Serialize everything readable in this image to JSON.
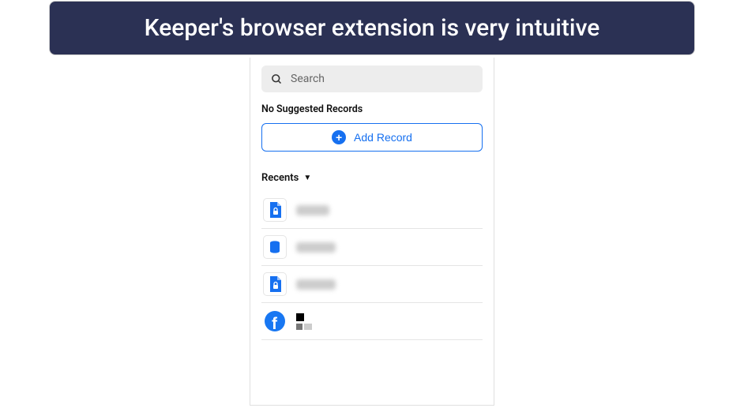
{
  "title": "Keeper's browser extension is very intuitive",
  "search": {
    "placeholder": "Search"
  },
  "noRecords": "No Suggested Records",
  "addRecord": "Add Record",
  "recents": {
    "label": "Recents",
    "items": [
      {
        "icon": "file-lock",
        "label": ""
      },
      {
        "icon": "database",
        "label": ""
      },
      {
        "icon": "file-lock",
        "label": ""
      },
      {
        "icon": "facebook",
        "label": ""
      }
    ]
  },
  "colors": {
    "accent": "#1670f0",
    "headerBg": "#2b3154"
  }
}
